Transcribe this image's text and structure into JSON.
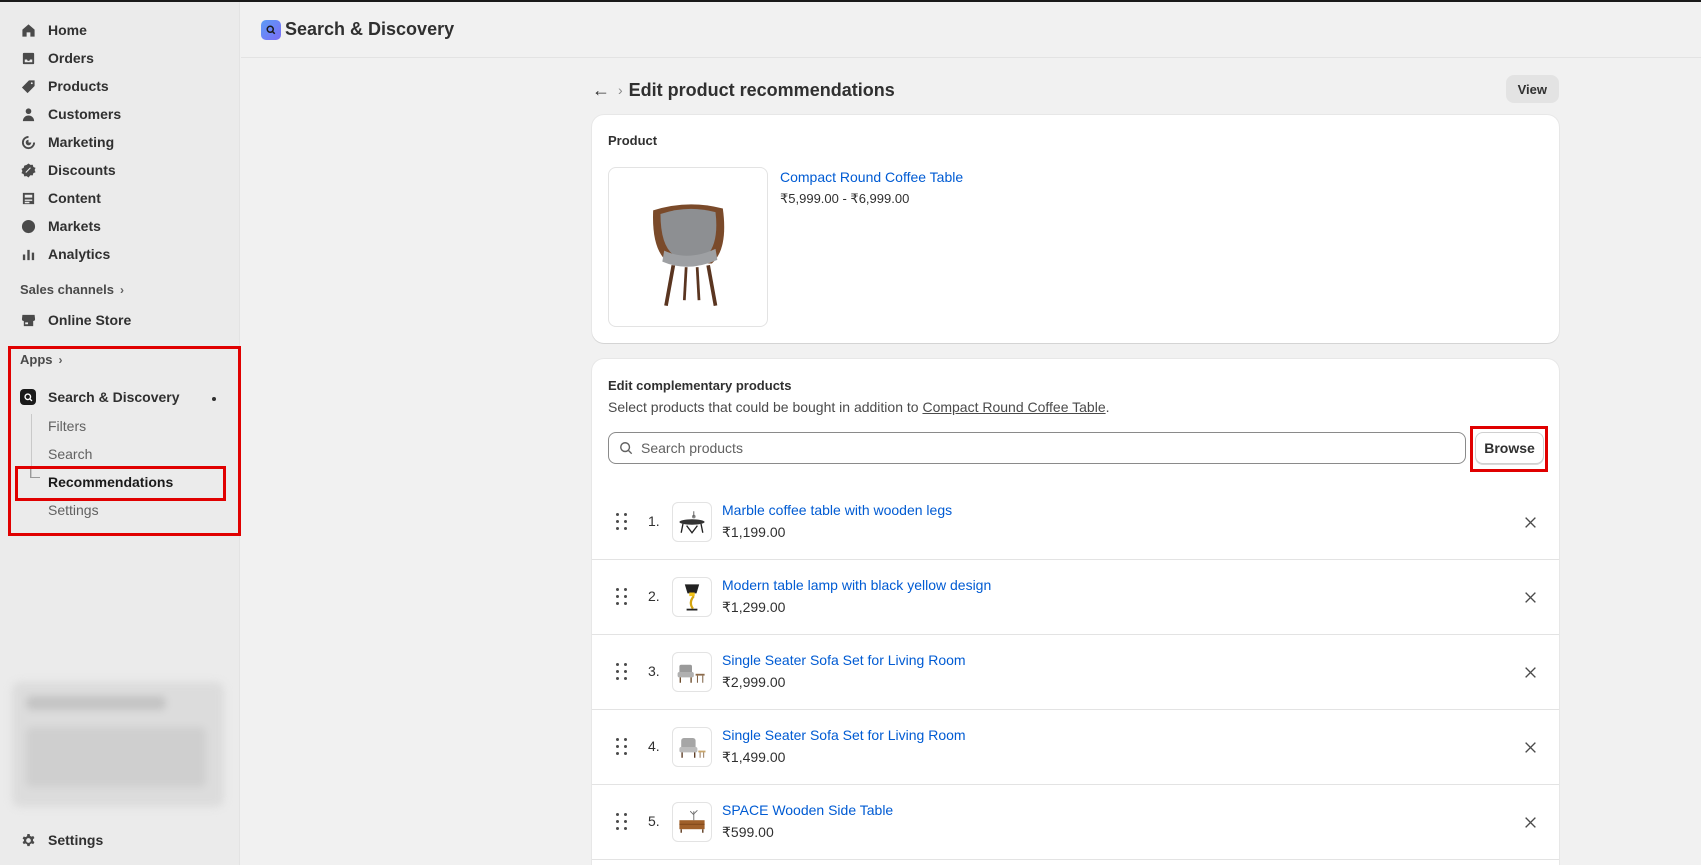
{
  "sidebar": {
    "nav": [
      {
        "label": "Home",
        "icon": "home-icon"
      },
      {
        "label": "Orders",
        "icon": "orders-icon"
      },
      {
        "label": "Products",
        "icon": "tag-icon"
      },
      {
        "label": "Customers",
        "icon": "person-icon"
      },
      {
        "label": "Marketing",
        "icon": "target-icon"
      },
      {
        "label": "Discounts",
        "icon": "discount-icon"
      },
      {
        "label": "Content",
        "icon": "content-icon"
      },
      {
        "label": "Markets",
        "icon": "globe-icon"
      },
      {
        "label": "Analytics",
        "icon": "chart-icon"
      }
    ],
    "sales_channels_label": "Sales channels",
    "online_store_label": "Online Store",
    "apps_label": "Apps",
    "app_name": "Search & Discovery",
    "app_sub_items": [
      "Filters",
      "Search",
      "Recommendations",
      "Settings"
    ],
    "settings_label": "Settings"
  },
  "header": {
    "app_title": "Search & Discovery"
  },
  "page": {
    "title": "Edit product recommendations",
    "view_label": "View"
  },
  "product_card": {
    "heading": "Product",
    "name": "Compact Round Coffee Table",
    "price": "₹5,999.00 - ₹6,999.00"
  },
  "complementary": {
    "heading": "Edit complementary products",
    "desc_prefix": "Select products that could be bought in addition to",
    "desc_link": "Compact Round Coffee Table",
    "desc_suffix": ".",
    "search_placeholder": "Search products",
    "browse_label": "Browse",
    "items": [
      {
        "num": "1.",
        "name": "Marble coffee table with wooden legs",
        "price": "₹1,199.00"
      },
      {
        "num": "2.",
        "name": "Modern table lamp with black yellow design",
        "price": "₹1,299.00"
      },
      {
        "num": "3.",
        "name": "Single Seater Sofa Set for Living Room",
        "price": "₹2,999.00"
      },
      {
        "num": "4.",
        "name": "Single Seater Sofa Set for Living Room",
        "price": "₹1,499.00"
      },
      {
        "num": "5.",
        "name": "SPACE Wooden Side Table",
        "price": "₹599.00"
      }
    ]
  },
  "colors": {
    "link": "#005bd3",
    "highlight": "#e00000"
  }
}
